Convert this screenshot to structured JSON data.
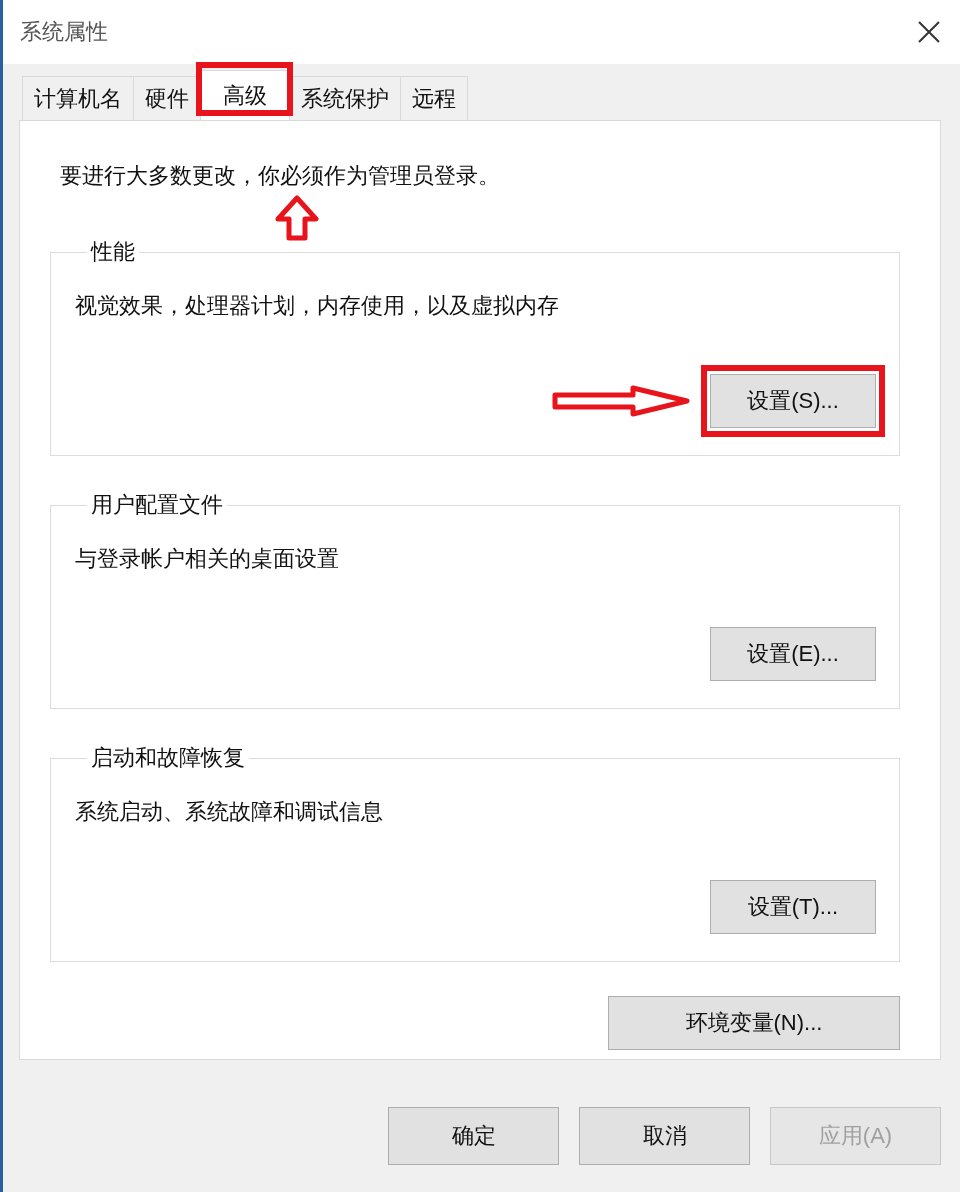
{
  "window": {
    "title": "系统属性"
  },
  "tabs": [
    {
      "label": "计算机名",
      "selected": false,
      "highlighted": false
    },
    {
      "label": "硬件",
      "selected": false,
      "highlighted": false
    },
    {
      "label": "高级",
      "selected": true,
      "highlighted": true
    },
    {
      "label": "系统保护",
      "selected": false,
      "highlighted": false
    },
    {
      "label": "远程",
      "selected": false,
      "highlighted": false
    }
  ],
  "notice": "要进行大多数更改，你必须作为管理员登录。",
  "groups": [
    {
      "title": "性能",
      "description": "视觉效果，处理器计划，内存使用，以及虚拟内存",
      "button": "设置(S)...",
      "highlighted": true
    },
    {
      "title": "用户配置文件",
      "description": "与登录帐户相关的桌面设置",
      "button": "设置(E)...",
      "highlighted": false
    },
    {
      "title": "启动和故障恢复",
      "description": "系统启动、系统故障和调试信息",
      "button": "设置(T)...",
      "highlighted": false
    }
  ],
  "env_button": "环境变量(N)...",
  "footer_buttons": [
    {
      "label": "确定",
      "disabled": false
    },
    {
      "label": "取消",
      "disabled": false
    },
    {
      "label": "应用(A)",
      "disabled": true
    }
  ]
}
